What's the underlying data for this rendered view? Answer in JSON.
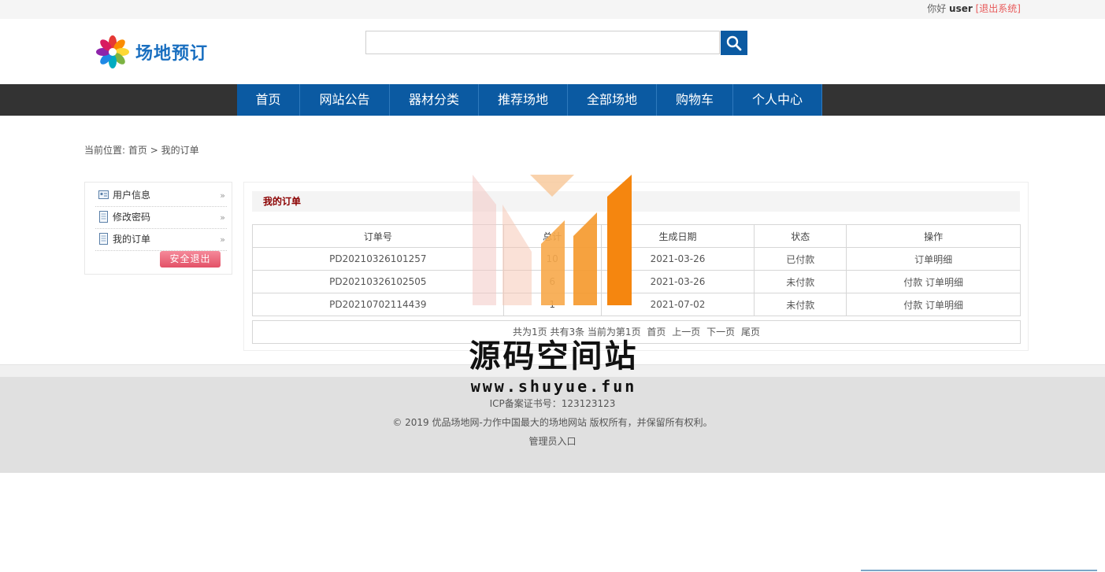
{
  "topbar": {
    "hello": "你好",
    "username": "user",
    "logout": "[退出系统]"
  },
  "header": {
    "logo_text": "场地预订",
    "search_placeholder": ""
  },
  "nav": [
    {
      "label": "首页",
      "w": 80
    },
    {
      "label": "网站公告",
      "w": 114
    },
    {
      "label": "器材分类",
      "w": 113
    },
    {
      "label": "推荐场地",
      "w": 113
    },
    {
      "label": "全部场地",
      "w": 113
    },
    {
      "label": "购物车",
      "w": 97
    },
    {
      "label": "个人中心",
      "w": 113
    }
  ],
  "breadcrumb": {
    "prefix": "当前位置:",
    "home": "首页",
    "sep": ">",
    "current": "我的订单"
  },
  "sidebar": {
    "items": [
      "用户信息",
      "修改密码",
      "我的订单"
    ],
    "arrow": "»",
    "logout": "安全退出"
  },
  "orders": {
    "title": "我的订单",
    "headers": [
      "订单号",
      "总计",
      "生成日期",
      "状态",
      "操作"
    ],
    "rows": [
      {
        "id": "PD20210326101257",
        "total": "10",
        "date": "2021-03-26",
        "status": "已付款",
        "pay": "",
        "detail": "订单明细"
      },
      {
        "id": "PD20210326102505",
        "total": "6",
        "date": "2021-03-26",
        "status": "未付款",
        "pay": "付款",
        "detail": "订单明细"
      },
      {
        "id": "PD20210702114439",
        "total": "1",
        "date": "2021-07-02",
        "status": "未付款",
        "pay": "付款",
        "detail": "订单明细"
      }
    ],
    "pager": {
      "info": "共为1页 共有3条 当前为第1页",
      "first": "首页",
      "prev": "上一页",
      "next": "下一页",
      "last": "尾页"
    }
  },
  "footer": {
    "icp": "ICP备案证书号：123123123",
    "copyright": "© 2019 优品场地网-力作中国最大的场地网站 版权所有，并保留所有权利。",
    "admin": "管理员入口"
  },
  "watermark": {
    "text": "源码空间站",
    "url": "www.shuyue.fun"
  },
  "colors": {
    "nav_blue": "#0b5aa2",
    "nav_bar": "#333333",
    "title_red": "#8b0000",
    "logout_red": "#e35167"
  }
}
